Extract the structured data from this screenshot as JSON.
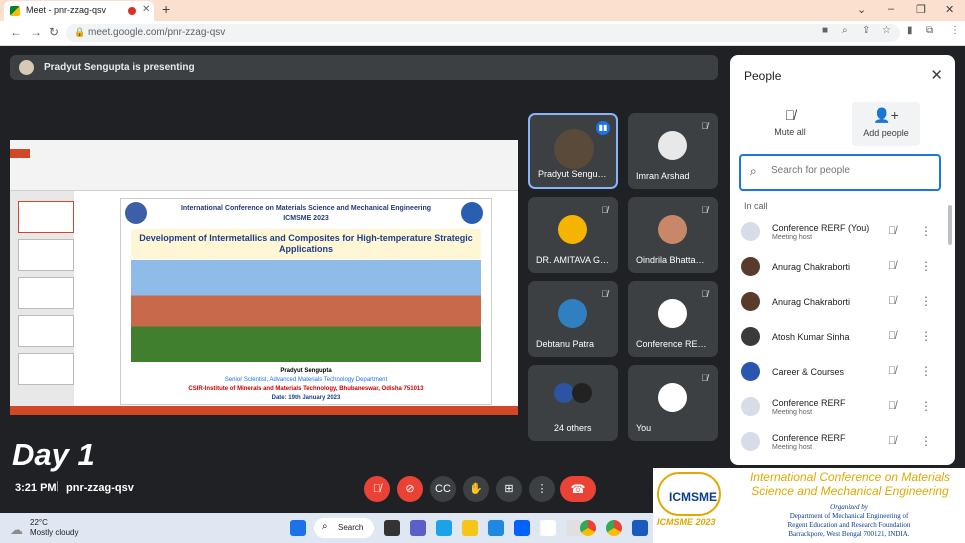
{
  "browser": {
    "tab_title": "Meet - pnr-zzag-qsv",
    "new_tab": "+",
    "url": "meet.google.com/pnr-zzag-qsv",
    "window_controls": [
      "⌄",
      "–",
      "❐",
      "✕"
    ]
  },
  "meet": {
    "presenting_text": "Pradyut Sengupta is presenting",
    "shared_slide": {
      "conference": "International Conference on Materials Science and Mechanical Engineering",
      "short_name": "ICMSME 2023",
      "title": "Development of Intermetallics and Composites for High-temperature Strategic Applications",
      "presenter": "Pradyut Sengupta",
      "role": "Senior Scientist, Advanced Materials Technology Department",
      "institute": "CSIR-Institute of Minerals and Materials Technology, Bhubaneswar, Odisha 751013",
      "date": "Date: 19th January 2023"
    },
    "tiles": [
      {
        "name": "Pradyut Sengu…",
        "color": "#5a4a3a"
      },
      {
        "name": "Imran Arshad",
        "color": "#e8e8e8"
      },
      {
        "name": "DR. AMITAVA G…",
        "color": "#f5b400"
      },
      {
        "name": "Oindrila Bhatta…",
        "color": "#c9876a"
      },
      {
        "name": "Debtanu Patra",
        "color": "#2f7fc1"
      },
      {
        "name": "Conference RE…",
        "color": "#ffffff"
      },
      {
        "name": "24 others",
        "color": "#2b55a3"
      },
      {
        "name": "You",
        "color": "#ffffff"
      }
    ],
    "day_label": "Day 1",
    "time": "3:21 PM",
    "meeting_code": "pnr-zzag-qsv",
    "separator": "|"
  },
  "people_panel": {
    "title": "People",
    "mute_all": "Mute all",
    "add_people": "Add people",
    "search_placeholder": "Search for people",
    "in_call": "In call",
    "participants": [
      {
        "name": "Conference RERF (You)",
        "sub": "Meeting host",
        "color": "#d8dbe8"
      },
      {
        "name": "Anurag Chakraborti",
        "sub": "",
        "color": "#5a3a2a"
      },
      {
        "name": "Anurag Chakraborti",
        "sub": "",
        "color": "#5a3a2a"
      },
      {
        "name": "Atosh Kumar Sinha",
        "sub": "",
        "color": "#3a3a3a"
      },
      {
        "name": "Career & Courses",
        "sub": "",
        "color": "#2a55b0"
      },
      {
        "name": "Conference RERF",
        "sub": "Meeting host",
        "color": "#d8dbe8"
      },
      {
        "name": "Conference RERF",
        "sub": "Meeting host",
        "color": "#d8dbe8"
      }
    ]
  },
  "banner": {
    "title": "International Conference on Materials Science and Mechanical Engineering",
    "logo_caption": "ICMSME 2023",
    "organized_by": "Organized by",
    "org_line1": "Department of Mechanical Engineering of",
    "org_line2": "Regent Education and Research Foundation",
    "org_line3": "Barrackpore, West Bengal 700121, INDIA."
  },
  "taskbar": {
    "temperature": "22°C",
    "condition": "Mostly cloudy",
    "search": "Search"
  },
  "colors": {
    "meet_bg": "#202124",
    "tile_bg": "#3c4043",
    "accent_blue": "#1a73e8",
    "end_red": "#ea4335",
    "banner_gold": "#e0a800",
    "banner_blue": "#0b3d91"
  }
}
